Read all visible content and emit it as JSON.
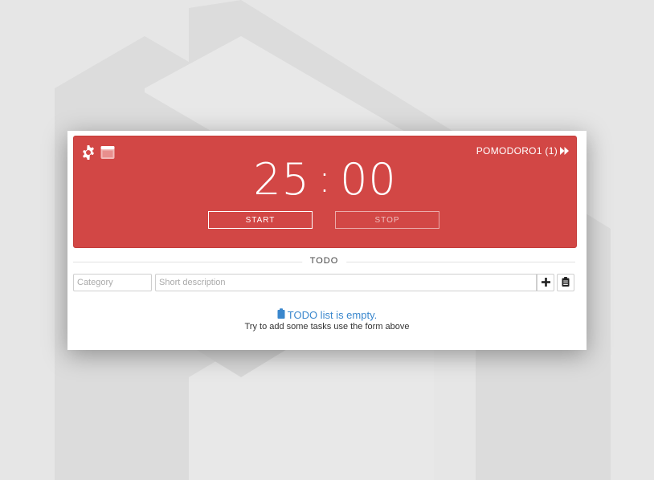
{
  "timer": {
    "minutes": "25",
    "separator": ":",
    "seconds": "00",
    "session_label": "POMODORO1 (1)",
    "start_label": "START",
    "stop_label": "STOP"
  },
  "todo": {
    "heading": "TODO",
    "category_placeholder": "Category",
    "description_placeholder": "Short description",
    "empty_title": "TODO list is empty.",
    "empty_subtitle": "Try to add some tasks use the form above"
  },
  "icons": {
    "settings": "gear-icon",
    "window": "window-icon",
    "skip": "fast-forward-icon",
    "add": "plus-icon",
    "clipboard": "clipboard-icon"
  },
  "colors": {
    "timer_bg": "#d24745",
    "page_bg": "#e6e6e6",
    "empty_text": "#3a87cd"
  }
}
